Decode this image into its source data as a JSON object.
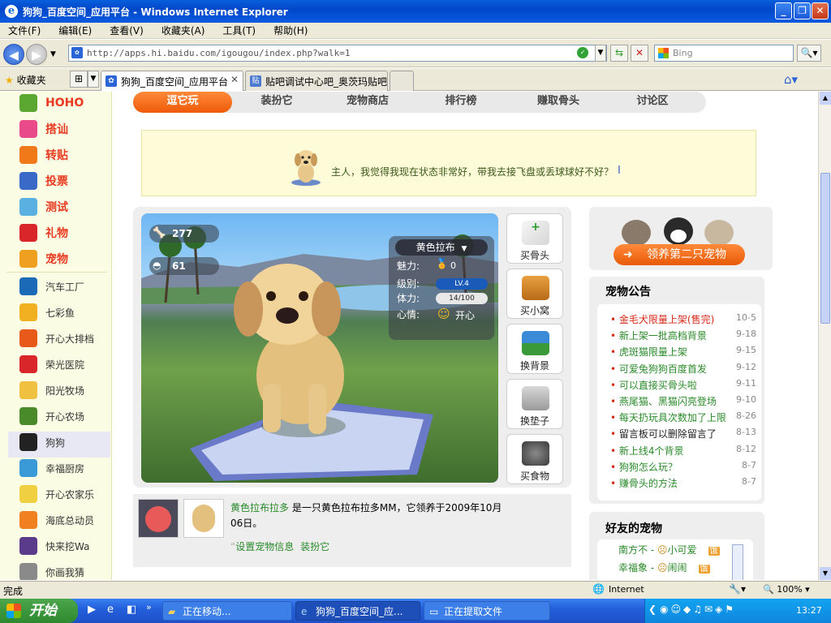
{
  "window": {
    "title": "狗狗_百度空间_应用平台 - Windows Internet Explorer"
  },
  "menu": [
    "文件(F)",
    "编辑(E)",
    "查看(V)",
    "收藏夹(A)",
    "工具(T)",
    "帮助(H)"
  ],
  "address": {
    "url": "http://apps.hi.baidu.com/igougou/index.php?walk=1",
    "search_placeholder": "Bing"
  },
  "favorites_label": "收藏夹",
  "tabs": [
    {
      "label": "狗狗_百度空间_应用平台",
      "active": true
    },
    {
      "label": "贴吧调试中心吧_奥茨玛贴吧",
      "active": false
    }
  ],
  "sidebar": {
    "top_items": [
      {
        "label": "HOHO",
        "icon": "hoho-icon",
        "color": "#5aa832"
      },
      {
        "label": "搭讪",
        "icon": "hi-icon",
        "color": "#e84a8a"
      },
      {
        "label": "转贴",
        "icon": "repost-icon",
        "color": "#f07a1a"
      },
      {
        "label": "投票",
        "icon": "vote-icon",
        "color": "#3a6ac8"
      },
      {
        "label": "测试",
        "icon": "test-icon",
        "color": "#5ab0e0"
      },
      {
        "label": "礼物",
        "icon": "gift-icon",
        "color": "#d8262a"
      },
      {
        "label": "宠物",
        "icon": "pet-icon",
        "color": "#f0a020"
      }
    ],
    "apps": [
      {
        "label": "汽车工厂",
        "icon": "car-factory-icon",
        "color": "#1a6ab8"
      },
      {
        "label": "七彩鱼",
        "icon": "fish-icon",
        "color": "#f0b020"
      },
      {
        "label": "开心大排档",
        "icon": "food-stall-icon",
        "color": "#e85a1a"
      },
      {
        "label": "荣光医院",
        "icon": "hospital-icon",
        "color": "#d8262a"
      },
      {
        "label": "阳光牧场",
        "icon": "ranch-icon",
        "color": "#f0c040"
      },
      {
        "label": "开心农场",
        "icon": "farm-icon",
        "color": "#4a8a2a"
      },
      {
        "label": "狗狗",
        "icon": "dog-paw-icon",
        "color": "#222222"
      },
      {
        "label": "幸福厨房",
        "icon": "kitchen-icon",
        "color": "#3a9ad8"
      },
      {
        "label": "开心农家乐",
        "icon": "chick-icon",
        "color": "#f0d040"
      },
      {
        "label": "海底总动员",
        "icon": "sea-icon",
        "color": "#f08020"
      },
      {
        "label": "快来挖Wa",
        "icon": "dig-icon",
        "color": "#5a3a8a"
      },
      {
        "label": "你画我猜",
        "icon": "draw-guess-icon",
        "color": "#8a8a8a"
      }
    ]
  },
  "page_tabs": [
    "逗它玩",
    "装扮它",
    "宠物商店",
    "排行榜",
    "赚取骨头",
    "讨论区"
  ],
  "speech": "主人，我觉得我现在状态非常好，带我去接飞盘或丢球球好不好？",
  "pet": {
    "bones": "277",
    "food": "61",
    "name": "黄色拉布",
    "charm_label": "魅力:",
    "charm": "0",
    "level_label": "级别:",
    "level": "LV.4",
    "stamina_label": "体力:",
    "stamina": "14/100",
    "mood_label": "心情:",
    "mood": "开心"
  },
  "side_buttons": [
    "买骨头",
    "买小窝",
    "换背景",
    "换垫子",
    "买食物"
  ],
  "info": {
    "name_link": "黄色拉布拉多",
    "desc": "是一只黄色拉布拉多MM，它领养于2009年10月06日。",
    "link_settings": "设置宠物信息",
    "link_dress": "装扮它"
  },
  "adopt_button": "领养第二只宠物",
  "notice": {
    "title": "宠物公告",
    "items": [
      {
        "text": "金毛犬限量上架(售完)",
        "date": "10-5",
        "highlight": true
      },
      {
        "text": "新上架一批高档背景",
        "date": "9-18"
      },
      {
        "text": "虎斑猫限量上架",
        "date": "9-15"
      },
      {
        "text": "可爱兔狗狗百度首发",
        "date": "9-12"
      },
      {
        "text": "可以直接买骨头啦",
        "date": "9-11"
      },
      {
        "text": "燕尾猫、黑猫闪亮登场",
        "date": "9-10"
      },
      {
        "text": "每天扔玩具次数加了上限",
        "date": "8-26"
      },
      {
        "text": "留言板可以删除留言了",
        "date": "8-13",
        "dark": true
      },
      {
        "text": "新上线4个背景",
        "date": "8-12"
      },
      {
        "text": "狗狗怎么玩？",
        "date": "8-7"
      },
      {
        "text": "赚骨头的方法",
        "date": "8-7"
      }
    ]
  },
  "friends": {
    "title": "好友的宠物",
    "items": [
      {
        "owner": "南方不",
        "pet": "小可爱",
        "badge": "饿"
      },
      {
        "owner": "幸福象",
        "pet": "闹闹",
        "badge": "饿"
      }
    ]
  },
  "status": {
    "text": "完成",
    "zone": "Internet",
    "zoom": "100%"
  },
  "taskbar": {
    "start": "开始",
    "tasks": [
      "正在移动...",
      "狗狗_百度空间_应...",
      "正在提取文件"
    ],
    "clock": "13:27"
  }
}
